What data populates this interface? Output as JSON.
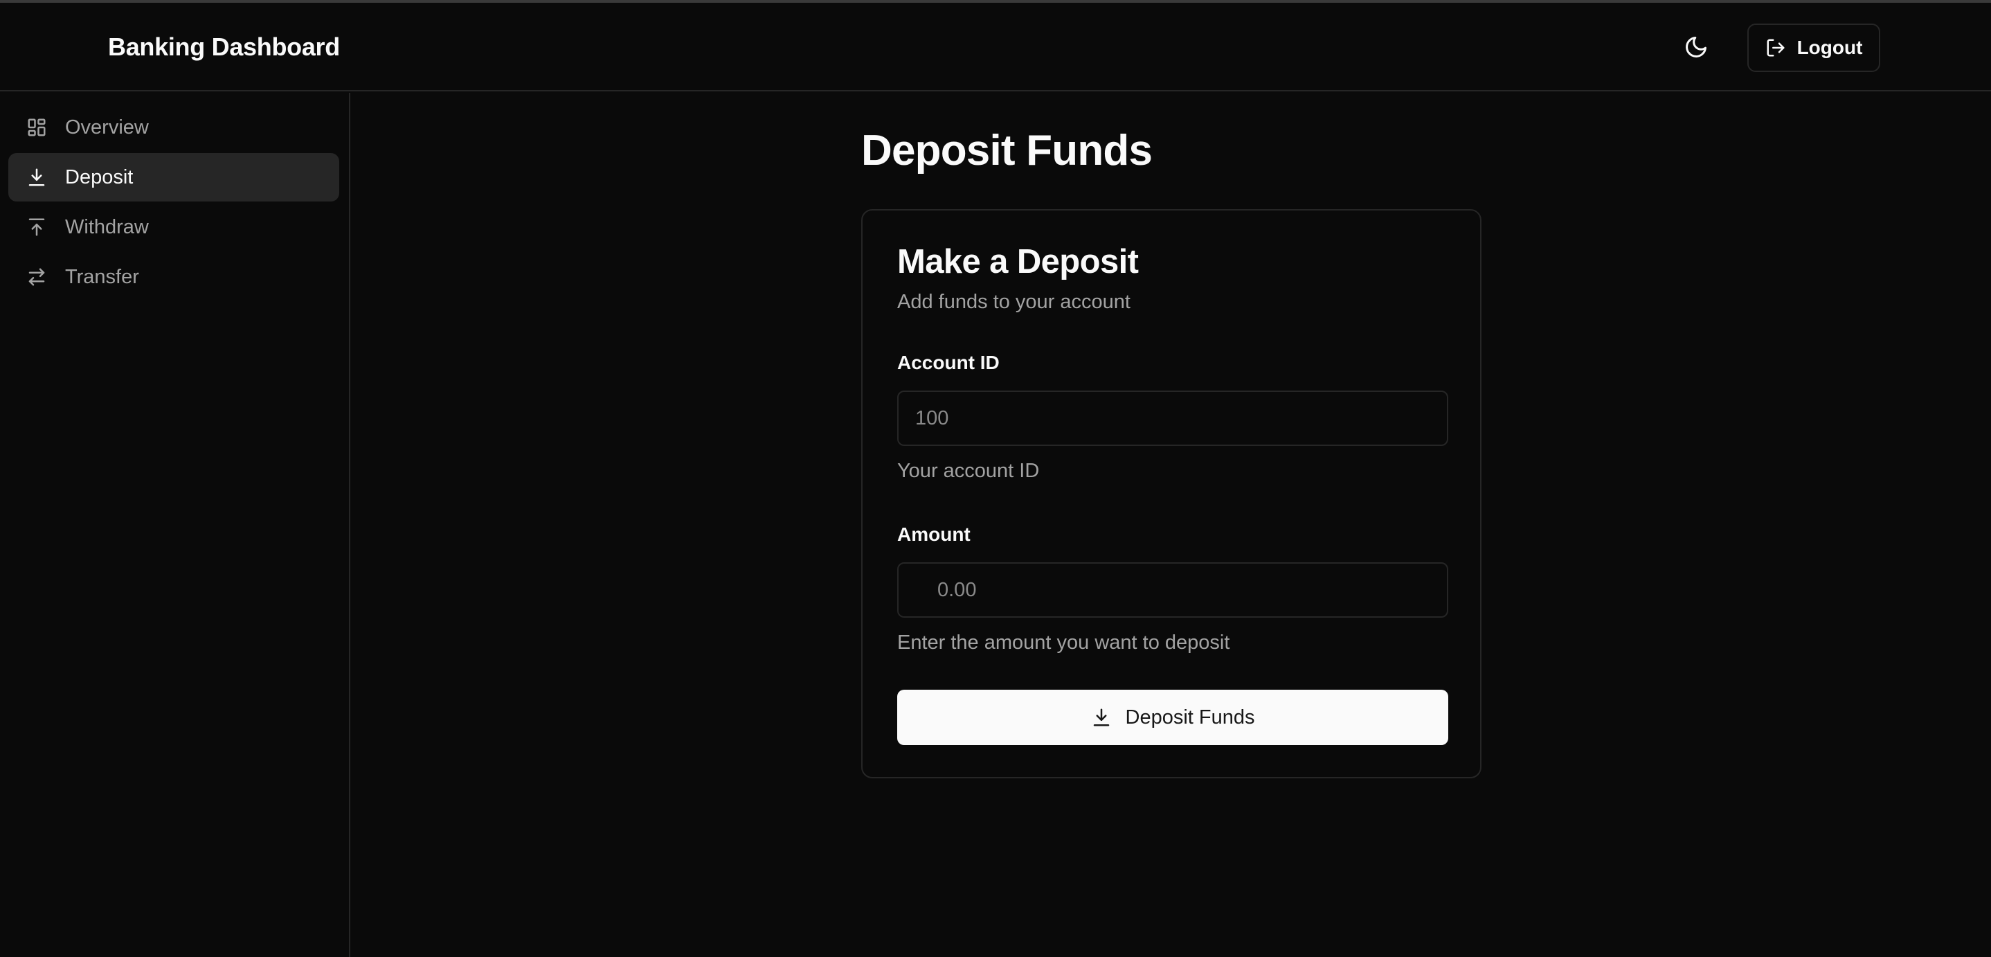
{
  "header": {
    "app_title": "Banking Dashboard",
    "theme_toggle_icon": "moon-icon",
    "logout_label": "Logout",
    "logout_icon": "logout-icon"
  },
  "sidebar": {
    "items": [
      {
        "label": "Overview",
        "icon": "grid-icon",
        "active": false
      },
      {
        "label": "Deposit",
        "icon": "download-icon",
        "active": true
      },
      {
        "label": "Withdraw",
        "icon": "upload-icon",
        "active": false
      },
      {
        "label": "Transfer",
        "icon": "arrows-left-right-icon",
        "active": false
      }
    ]
  },
  "main": {
    "page_title": "Deposit Funds",
    "card": {
      "title": "Make a Deposit",
      "subtitle": "Add funds to your account",
      "account_field": {
        "label": "Account ID",
        "value": "",
        "placeholder": "100",
        "help": "Your account ID"
      },
      "amount_field": {
        "label": "Amount",
        "value": "",
        "placeholder": "0.00",
        "help": "Enter the amount you want to deposit"
      },
      "submit_label": "Deposit Funds",
      "submit_icon": "download-icon"
    }
  },
  "colors": {
    "background": "#0a0a0a",
    "border": "#262626",
    "text": "#fafafa",
    "muted_text": "#a3a3a3",
    "active_nav_bg": "#262626",
    "primary_button_bg": "#fafafa"
  }
}
